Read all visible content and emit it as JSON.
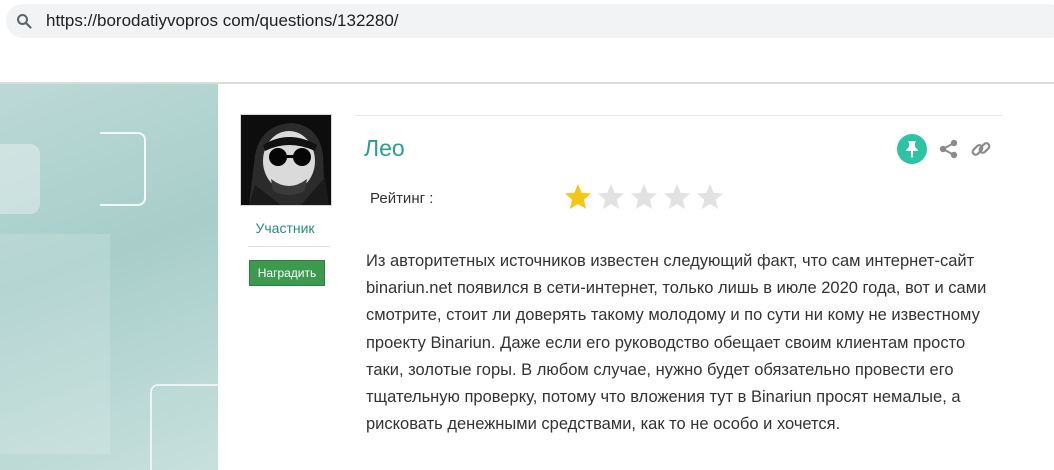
{
  "browser": {
    "url": "https://borodatiyvopros com/questions/132280/",
    "search_icon": "search-icon"
  },
  "user": {
    "name": "Лео",
    "role": "Участник",
    "reward_label": "Наградить",
    "avatar": "avatar-image"
  },
  "actions": {
    "pin_icon": "pin-icon",
    "share_icon": "share-icon",
    "link_icon": "link-icon",
    "accent_color": "#2ec4a3"
  },
  "rating": {
    "label": "Рейтинг :",
    "value": 1,
    "max": 5,
    "filled_color": "#f5c518",
    "empty_color": "#e2e2e2"
  },
  "post": {
    "text": "Из авторитетных источников известен следующий факт, что сам интернет-сайт binariun.net появился в сети-интернет, только лишь в июле 2020 года, вот и сами смотрите, стоит ли доверять такому молодому и по сути ни кому не известному проекту Binariun. Даже если его руководство обещает своим клиентам просто таки, золотые горы. В любом случае, нужно будет обязательно провести его тщательную проверку, потому что вложения тут в Binariun просят немалые, а рисковать денежными средствами, как то не особо и хочется."
  }
}
